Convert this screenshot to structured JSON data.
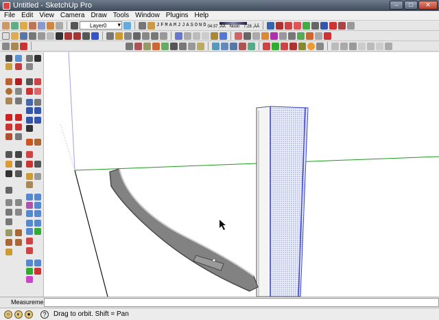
{
  "window": {
    "title": "Untitled - SketchUp Pro"
  },
  "menu": [
    "File",
    "Edit",
    "View",
    "Camera",
    "Draw",
    "Tools",
    "Window",
    "Plugins",
    "Help"
  ],
  "layers": {
    "current": "Layer0"
  },
  "shadows": {
    "months": [
      "J",
      "F",
      "M",
      "A",
      "M",
      "J",
      "J",
      "A",
      "S",
      "O",
      "N",
      "D"
    ],
    "time_start": "04:37 ,ÄÂ",
    "noon": "Noon",
    "time_end": "7:28 ,ÄÂ"
  },
  "measurements": {
    "label": "Measurements",
    "value": ""
  },
  "status": {
    "hint": "Drag to orbit.  Shift = Pan"
  },
  "colors": {
    "green_axis": "#1a9a1a",
    "red_axis": "#c03030",
    "blue_axis": "#3333cc",
    "blade_gray": "#7a7a7a",
    "selection_blue": "#3b46c8"
  },
  "icons": [
    "app-icon",
    "minimize-icon",
    "maximize-icon",
    "close-icon",
    "cursor-icon",
    "orbit-icon",
    "help-icon"
  ]
}
